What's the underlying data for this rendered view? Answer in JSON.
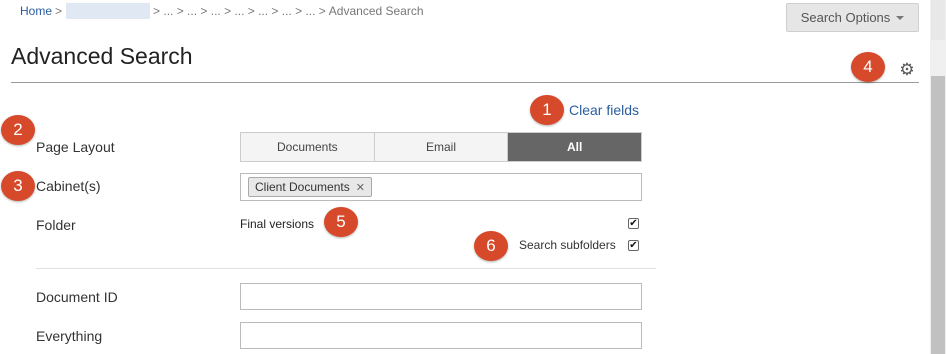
{
  "breadcrumb": {
    "home": "Home",
    "middle": "> ... > ... > ... > ... > ... > ... > ... >",
    "current": "Advanced Search"
  },
  "search_options": {
    "label": "Search Options"
  },
  "page": {
    "title": "Advanced Search"
  },
  "clear_fields": "Clear fields",
  "badges": [
    "1",
    "2",
    "3",
    "4",
    "5",
    "6"
  ],
  "form": {
    "page_layout": {
      "label": "Page Layout",
      "options": [
        "Documents",
        "Email",
        "All"
      ],
      "selected": "All"
    },
    "cabinets": {
      "label": "Cabinet(s)",
      "chip": "Client Documents",
      "chip_remove": "✕"
    },
    "folder": {
      "label": "Folder",
      "value": "Final versions",
      "checked": true,
      "search_subfolders": {
        "label": "Search subfolders",
        "checked": true
      }
    },
    "document_id": {
      "label": "Document ID",
      "value": ""
    },
    "everything": {
      "label": "Everything",
      "value": ""
    }
  },
  "icons": {
    "settings": "gear-icon",
    "dropdown": "caret-down-icon",
    "check": "✔"
  },
  "colors": {
    "link": "#2a5d9f",
    "badge": "#d6492a",
    "active_segment": "#666666"
  }
}
